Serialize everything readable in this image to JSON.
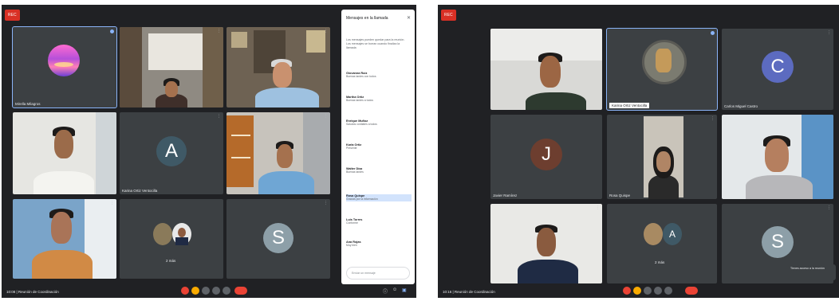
{
  "left": {
    "rec_label": "REC",
    "tiles": [
      {
        "name": "Mirella Milagros",
        "letter": ""
      },
      {
        "name": "",
        "letter": ""
      },
      {
        "name": "",
        "letter": ""
      },
      {
        "name": "",
        "letter": ""
      },
      {
        "name": "Karina Ortiz Ventocilla",
        "letter": "A"
      },
      {
        "name": "",
        "letter": ""
      },
      {
        "name": "",
        "letter": ""
      },
      {
        "name": "2 más",
        "letter": ""
      },
      {
        "name": "",
        "letter": "S"
      }
    ],
    "chat": {
      "title": "Mensajes en la llamada",
      "option": "Los mensajes pueden quedar para la reunión. Los mensajes se borran cuando finaliza la llamada",
      "messages": [
        {
          "who": "Giovanna Ruiz",
          "text": "Buenas tardes con todos"
        },
        {
          "who": "Martha Ortiz",
          "text": "Buenas tardes a todos"
        },
        {
          "who": "Enrique Muñoz",
          "text": "Saludos cordiales a todos"
        },
        {
          "who": "Karla Ortiz",
          "text": "Presente"
        },
        {
          "who": "Walter Díaz",
          "text": "Buenas tardes"
        },
        {
          "who": "Rosa Quispe",
          "text": "Gracias por la información"
        },
        {
          "who": "Luis Torres",
          "text": "Conforme"
        },
        {
          "who": "Ana Rojas",
          "text": "Muy bien"
        }
      ],
      "input_placeholder": "Enviar un mensaje"
    },
    "meeting_info": "10:08 | Reunión de Coordinación"
  },
  "right": {
    "rec_label": "REC",
    "tiles": [
      {
        "name": "",
        "letter": ""
      },
      {
        "name": "Karina Ortiz Ventocilla",
        "letter": ""
      },
      {
        "name": "Carlos Miguel Castro",
        "letter": "C"
      },
      {
        "name": "Javier Ramírez",
        "letter": "J"
      },
      {
        "name": "Rosa Quispe",
        "letter": ""
      },
      {
        "name": "",
        "letter": ""
      },
      {
        "name": "",
        "letter": ""
      },
      {
        "name": "2 más",
        "letter": "A"
      },
      {
        "name": "",
        "letter": "S"
      }
    ],
    "meeting_info": "10:16 | Reunión de Coordinación",
    "notice": "Tienes acceso a la reunión"
  },
  "colors": {
    "bg_dark": "#202124",
    "tile": "#3c4043",
    "av_a": "#3f5966",
    "av_s": "#8d9fa8",
    "av_c": "#5c6bc0",
    "av_j": "#6d3e2f",
    "end_call": "#ea4335",
    "selected": "#8ab4f8"
  }
}
